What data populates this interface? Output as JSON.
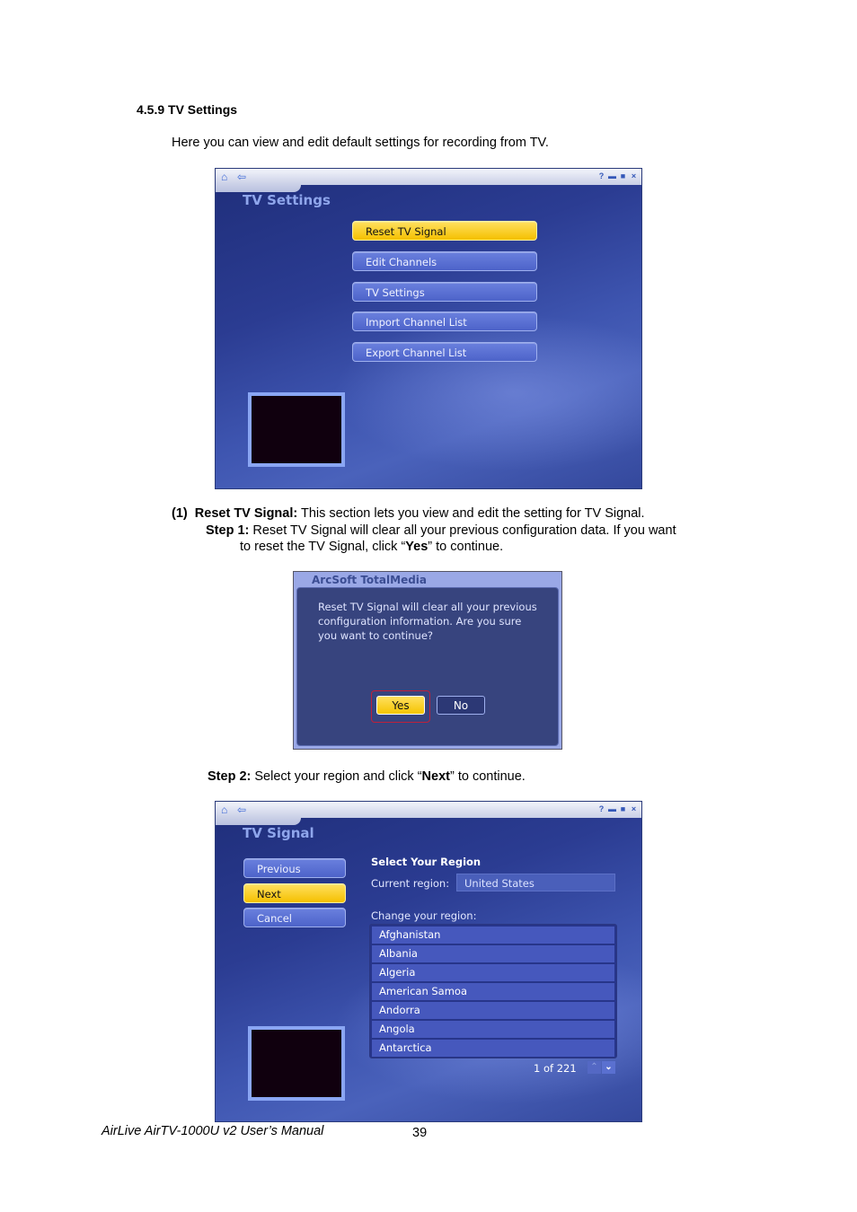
{
  "section_heading": "4.5.9 TV Settings",
  "intro": "Here you can view and edit default settings for recording from TV.",
  "screenshot1": {
    "title": "TV Settings",
    "titlebar_icons": [
      "home-icon",
      "back-icon",
      "help-icon",
      "minimize-icon",
      "maximize-icon",
      "close-icon"
    ],
    "menu": [
      {
        "label": "Reset TV Signal",
        "active": true
      },
      {
        "label": "Edit Channels",
        "active": false
      },
      {
        "label": "TV Settings",
        "active": false
      },
      {
        "label": "Import Channel List",
        "active": false
      },
      {
        "label": "Export Channel List",
        "active": false
      }
    ]
  },
  "item1": {
    "number": "(1)",
    "title": "Reset TV Signal:",
    "text": " This section lets you view and edit the setting for TV Signal.",
    "step1_label": "Step 1:",
    "step1_text_a": " Reset TV Signal will clear all your previous configuration data. If you want",
    "step1_text_b": "to reset the TV Signal, click “",
    "step1_bold": "Yes",
    "step1_text_c": "” to continue."
  },
  "dialog": {
    "title": "ArcSoft TotalMedia",
    "message": "Reset TV Signal will clear all your previous configuration information. Are you sure you want to continue?",
    "yes_label": "Yes",
    "no_label": "No"
  },
  "step2": {
    "label": "Step 2:",
    "text_a": " Select your region and click “",
    "bold": "Next",
    "text_b": "” to continue."
  },
  "screenshot2": {
    "title": "TV Signal",
    "buttons": [
      {
        "label": "Previous",
        "active": false
      },
      {
        "label": "Next",
        "active": true
      },
      {
        "label": "Cancel",
        "active": false
      }
    ],
    "select_heading": "Select Your Region",
    "current_label": "Current region:",
    "current_value": "United States",
    "change_label": "Change your region:",
    "regions": [
      "Afghanistan",
      "Albania",
      "Algeria",
      "American Samoa",
      "Andorra",
      "Angola",
      "Antarctica"
    ],
    "pager": "1 of 221"
  },
  "footer": {
    "manual": "AirLive AirTV-1000U v2 User’s Manual",
    "page": "39"
  }
}
